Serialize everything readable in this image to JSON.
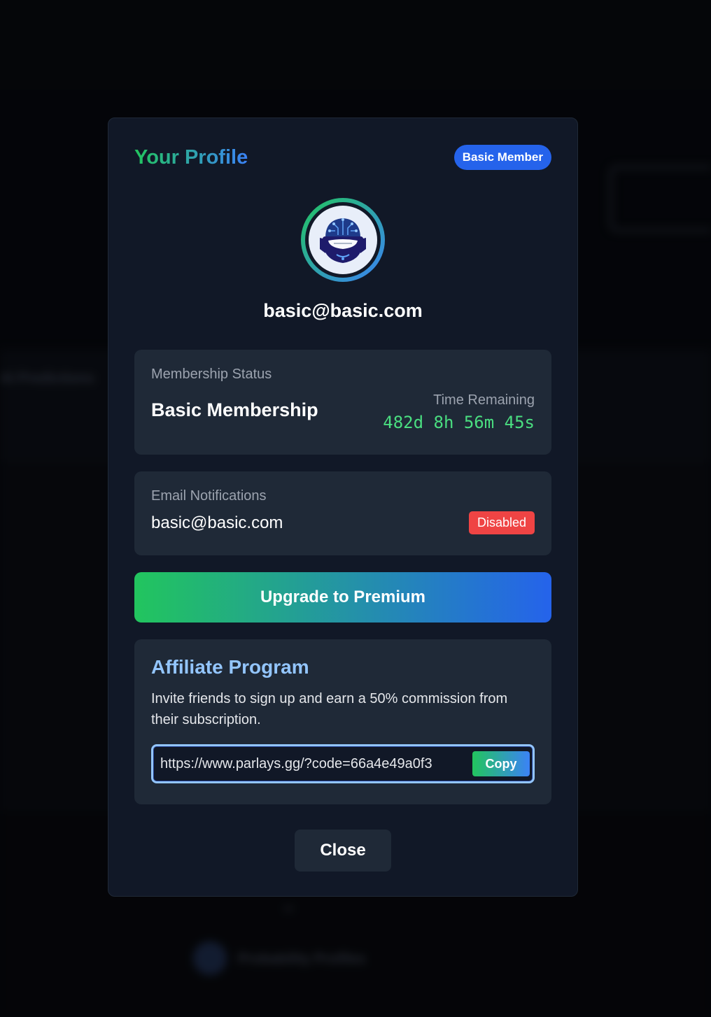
{
  "background": {
    "blurred_text_1": "AI Predictions",
    "blurred_text_2": "Probability Profiles",
    "blurred_text_3": "vs"
  },
  "modal": {
    "title": "Your Profile",
    "member_badge": "Basic Member",
    "avatar_icon": "robot-avatar",
    "email": "basic@basic.com"
  },
  "membership": {
    "label": "Membership Status",
    "name": "Basic Membership",
    "time_label": "Time Remaining",
    "time_value": "482d 8h 56m 45s"
  },
  "notifications": {
    "label": "Email Notifications",
    "email": "basic@basic.com",
    "status": "Disabled"
  },
  "upgrade": {
    "label": "Upgrade to Premium"
  },
  "affiliate": {
    "title": "Affiliate Program",
    "description": "Invite friends to sign up and earn a 50% commission from their subscription.",
    "link": "https://www.parlays.gg/?code=66a4e49a0f3",
    "copy_label": "Copy"
  },
  "close_label": "Close",
  "colors": {
    "accent_green": "#22c55e",
    "accent_blue": "#3b82f6",
    "danger": "#ef4444",
    "modal_bg": "#111827",
    "card_bg": "#1f2937"
  }
}
